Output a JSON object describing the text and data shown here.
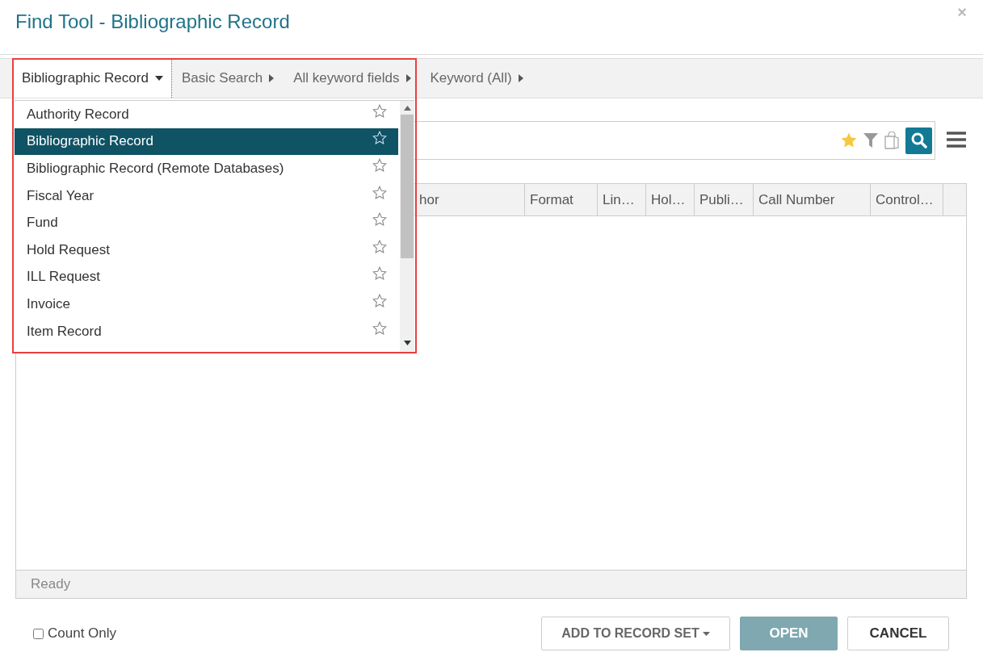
{
  "dialog": {
    "title": "Find Tool - Bibliographic Record",
    "close": "×"
  },
  "breadcrumbs": [
    {
      "label": "Bibliographic Record",
      "kind": "dropdown",
      "open": true
    },
    {
      "label": "Basic Search",
      "kind": "step"
    },
    {
      "label": "All keyword fields",
      "kind": "step"
    },
    {
      "label": "Keyword (All)",
      "kind": "step"
    }
  ],
  "record_types": [
    {
      "label": "Authority Record",
      "selected": false,
      "favorite": false
    },
    {
      "label": "Bibliographic Record",
      "selected": true,
      "favorite": false
    },
    {
      "label": "Bibliographic Record (Remote Databases)",
      "selected": false,
      "favorite": false
    },
    {
      "label": "Fiscal Year",
      "selected": false,
      "favorite": false
    },
    {
      "label": "Fund",
      "selected": false,
      "favorite": false
    },
    {
      "label": "Hold Request",
      "selected": false,
      "favorite": false
    },
    {
      "label": "ILL Request",
      "selected": false,
      "favorite": false
    },
    {
      "label": "Invoice",
      "selected": false,
      "favorite": false
    },
    {
      "label": "Item Record",
      "selected": false,
      "favorite": false
    }
  ],
  "table": {
    "columns": [
      "hor",
      "Format",
      "Lin…",
      "Hol…",
      "Publi…",
      "Call Number",
      "Control…"
    ]
  },
  "status_bar": "Ready",
  "count_only": {
    "label": "Count Only",
    "checked": false
  },
  "buttons": [
    {
      "label": "ADD TO RECORD SET",
      "kind": "menu",
      "disabled": false
    },
    {
      "label": "OPEN",
      "kind": "primary",
      "disabled": true
    },
    {
      "label": "CANCEL",
      "kind": "default",
      "disabled": false
    }
  ]
}
